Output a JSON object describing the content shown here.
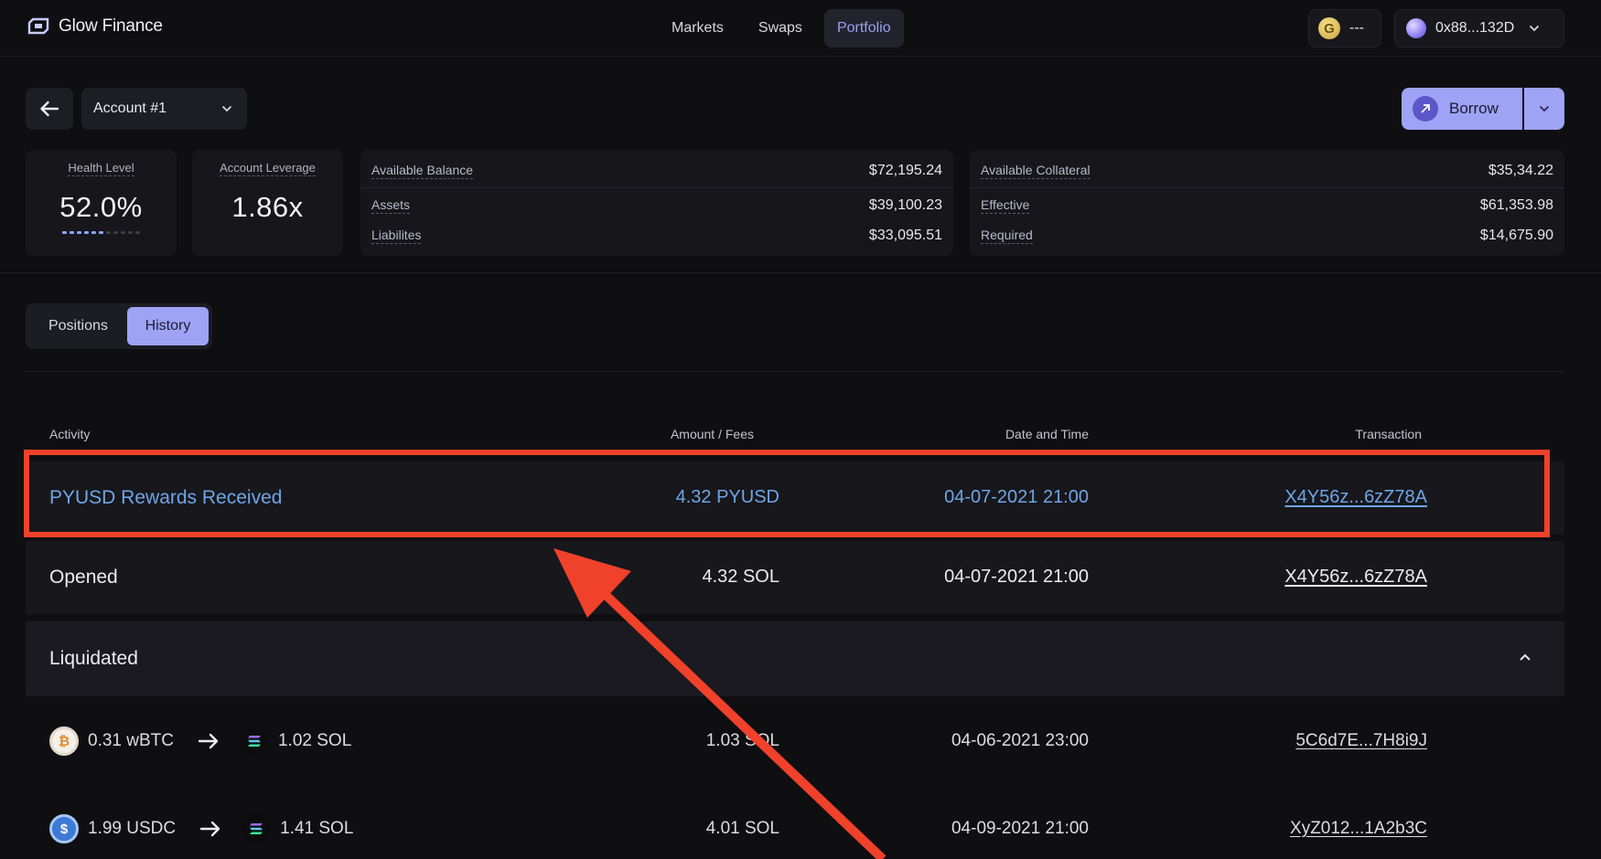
{
  "brand": {
    "name": "Glow Finance"
  },
  "nav": {
    "markets": "Markets",
    "swaps": "Swaps",
    "portfolio": "Portfolio"
  },
  "token_chip": {
    "symbol": "G",
    "value": "---"
  },
  "wallet": {
    "address": "0x88...132D"
  },
  "account": {
    "label": "Account #1"
  },
  "borrow": {
    "label": "Borrow"
  },
  "stats": {
    "health_label": "Health Level",
    "health_value": "52.0%",
    "health_level": 0.52,
    "leverage_label": "Account Leverage",
    "leverage_value": "1.86x"
  },
  "balance": {
    "available_label": "Available Balance",
    "available_value": "$72,195.24",
    "assets_label": "Assets",
    "assets_value": "$39,100.23",
    "liabilities_label": "Liabilites",
    "liabilities_value": "$33,095.51"
  },
  "collateral": {
    "available_label": "Available Collateral",
    "available_value": "$35,34.22",
    "effective_label": "Effective",
    "effective_value": "$61,353.98",
    "required_label": "Required",
    "required_value": "$14,675.90"
  },
  "tabs": {
    "positions": "Positions",
    "history": "History"
  },
  "table": {
    "headers": {
      "activity": "Activity",
      "amount": "Amount / Fees",
      "date": "Date and Time",
      "tx": "Transaction"
    },
    "rows": [
      {
        "activity": "PYUSD Rewards Received",
        "amount": "4.32 PYUSD",
        "date": "04-07-2021 21:00",
        "tx": "X4Y56z...6zZ78A"
      },
      {
        "activity": "Opened",
        "amount": "4.32 SOL",
        "date": "04-07-2021 21:00",
        "tx": "X4Y56z...6zZ78A"
      },
      {
        "activity": "Liquidated"
      }
    ],
    "swaps": [
      {
        "from": "0.31 wBTC",
        "to": "1.02 SOL",
        "amount": "1.03 SOL",
        "date": "04-06-2021 23:00",
        "tx": "5C6d7E...7H8i9J"
      },
      {
        "from": "1.99 USDC",
        "to": "1.41 SOL",
        "amount": "4.01 SOL",
        "date": "04-09-2021 21:00",
        "tx": "XyZ012...1A2b3C"
      }
    ]
  },
  "colors": {
    "accent": "#9ea3f6",
    "link": "#6ea6e6",
    "annotation": "#f0412a"
  }
}
